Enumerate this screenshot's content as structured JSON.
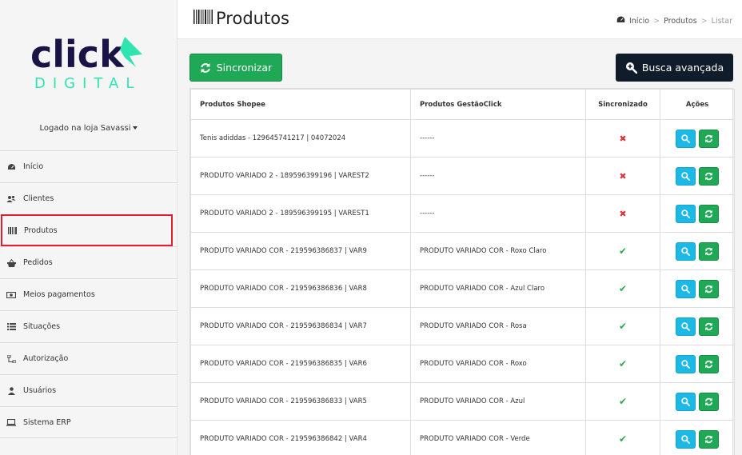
{
  "brand": {
    "top": "click",
    "bottom": "DIGITAL",
    "color_dark": "#1a1446",
    "color_accent": "#2ee5b0"
  },
  "sidebar": {
    "login_text": "Logado na loja Savassi",
    "items": [
      {
        "label": "Início",
        "icon": "dashboard-icon"
      },
      {
        "label": "Clientes",
        "icon": "users-icon"
      },
      {
        "label": "Produtos",
        "icon": "barcode-icon",
        "active": true
      },
      {
        "label": "Pedidos",
        "icon": "basket-icon"
      },
      {
        "label": "Meios pagamentos",
        "icon": "money-icon"
      },
      {
        "label": "Situações",
        "icon": "list-icon"
      },
      {
        "label": "Autorização",
        "icon": "sitemap-icon"
      },
      {
        "label": "Usuários",
        "icon": "user-icon"
      },
      {
        "label": "Sistema ERP",
        "icon": "laptop-icon"
      }
    ]
  },
  "header": {
    "title": "Produtos",
    "breadcrumb": [
      "Início",
      "Produtos",
      "Listar"
    ]
  },
  "toolbar": {
    "sync_label": "Sincronizar",
    "search_label": "Busca avançada"
  },
  "table": {
    "columns": [
      "Produtos Shopee",
      "Produtos GestãoClick",
      "Sincronizado",
      "Ações"
    ],
    "rows": [
      {
        "shopee": "Tenis adiddas - 129645741217 | 04072024",
        "gestao": "------",
        "synced": false
      },
      {
        "shopee": "PRODUTO VARIADO 2 - 189596399196 | VAREST2",
        "gestao": "------",
        "synced": false
      },
      {
        "shopee": "PRODUTO VARIADO 2 - 189596399195 | VAREST1",
        "gestao": "------",
        "synced": false
      },
      {
        "shopee": "PRODUTO VARIADO COR - 219596386837 | VAR9",
        "gestao": "PRODUTO VARIADO COR - Roxo Claro",
        "synced": true
      },
      {
        "shopee": "PRODUTO VARIADO COR - 219596386836 | VAR8",
        "gestao": "PRODUTO VARIADO COR - Azul Claro",
        "synced": true
      },
      {
        "shopee": "PRODUTO VARIADO COR - 219596386834 | VAR7",
        "gestao": "PRODUTO VARIADO COR - Rosa",
        "synced": true
      },
      {
        "shopee": "PRODUTO VARIADO COR - 219596386835 | VAR6",
        "gestao": "PRODUTO VARIADO COR - Roxo",
        "synced": true
      },
      {
        "shopee": "PRODUTO VARIADO COR - 219596386833 | VAR5",
        "gestao": "PRODUTO VARIADO COR - Azul",
        "synced": true
      },
      {
        "shopee": "PRODUTO VARIADO COR - 219596386842 | VAR4",
        "gestao": "PRODUTO VARIADO COR - Verde",
        "synced": true
      }
    ]
  }
}
